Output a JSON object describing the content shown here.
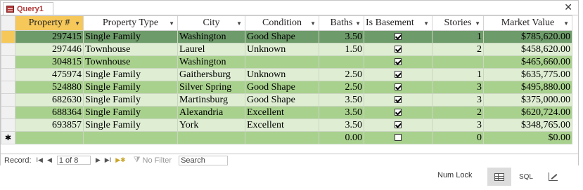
{
  "tab": {
    "label": "Query1",
    "close_glyph": "✕"
  },
  "columns": [
    {
      "label": "Property #"
    },
    {
      "label": "Property Type"
    },
    {
      "label": "City"
    },
    {
      "label": "Condition"
    },
    {
      "label": "Baths"
    },
    {
      "label": "Is Basement"
    },
    {
      "label": "Stories"
    },
    {
      "label": "Market Value"
    }
  ],
  "rows": [
    {
      "property": "297415",
      "type": "Single Family",
      "city": "Washington",
      "condition": "Good Shape",
      "baths": "3.50",
      "basement": true,
      "stories": "1",
      "value": "$785,620.00"
    },
    {
      "property": "297446",
      "type": "Townhouse",
      "city": "Laurel",
      "condition": "Unknown",
      "baths": "1.50",
      "basement": true,
      "stories": "2",
      "value": "$458,620.00"
    },
    {
      "property": "304815",
      "type": "Townhouse",
      "city": "Washington",
      "condition": "",
      "baths": "",
      "basement": true,
      "stories": "",
      "value": "$465,660.00"
    },
    {
      "property": "475974",
      "type": "Single Family",
      "city": "Gaithersburg",
      "condition": "Unknown",
      "baths": "2.50",
      "basement": true,
      "stories": "1",
      "value": "$635,775.00"
    },
    {
      "property": "524880",
      "type": "Single Family",
      "city": "Silver Spring",
      "condition": "Good Shape",
      "baths": "2.50",
      "basement": true,
      "stories": "3",
      "value": "$495,880.00"
    },
    {
      "property": "682630",
      "type": "Single Family",
      "city": "Martinsburg",
      "condition": "Good Shape",
      "baths": "3.50",
      "basement": true,
      "stories": "3",
      "value": "$375,000.00"
    },
    {
      "property": "688364",
      "type": "Single Family",
      "city": "Alexandria",
      "condition": "Excellent",
      "baths": "3.50",
      "basement": true,
      "stories": "2",
      "value": "$620,724.00"
    },
    {
      "property": "693857",
      "type": "Single Family",
      "city": "York",
      "condition": "Excellent",
      "baths": "3.50",
      "basement": true,
      "stories": "3",
      "value": "$348,765.00"
    }
  ],
  "new_row": {
    "marker": "✱",
    "baths": "0.00",
    "basement": false,
    "stories": "0",
    "value": "$0.00"
  },
  "navigator": {
    "record_label": "Record:",
    "first_glyph": "I◀",
    "prev_glyph": "◀",
    "current": "1 of 8",
    "next_glyph": "▶",
    "last_glyph": "▶I",
    "new_glyph": "▶✱",
    "no_filter_label": "No Filter",
    "search_label": "Search"
  },
  "status_bar": {
    "num_lock": "Num Lock",
    "sql_label": "SQL"
  },
  "colors": {
    "accent_tab": "#b23a3a",
    "row_light": "#dfeed3",
    "row_dark": "#a9d18e",
    "row_current": "#6e9b6a",
    "selected_header": "#f6c85a"
  }
}
